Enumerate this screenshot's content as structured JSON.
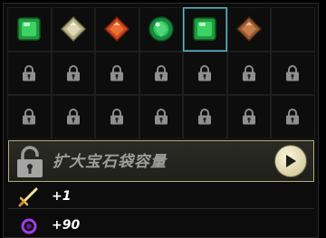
{
  "gem_slots": [
    {
      "gem": "green-square-gem"
    },
    {
      "gem": "beige-diamond-gem"
    },
    {
      "gem": "orange-diamond-gem"
    },
    {
      "gem": "green-round-gem"
    },
    {
      "gem": "green-square-gem",
      "selected": true
    },
    {
      "gem": "brown-diamond-gem"
    },
    {
      "gem": null
    }
  ],
  "locked_rows": 2,
  "expand": {
    "label": "扩大宝石袋容量"
  },
  "stats": [
    {
      "icon": "sword-icon",
      "value": "+1"
    },
    {
      "icon": "magic-orb-icon",
      "value": "+90"
    }
  ],
  "colors": {
    "selected_border": "#5fb8c8",
    "expand_border": "#b6ae7a"
  }
}
